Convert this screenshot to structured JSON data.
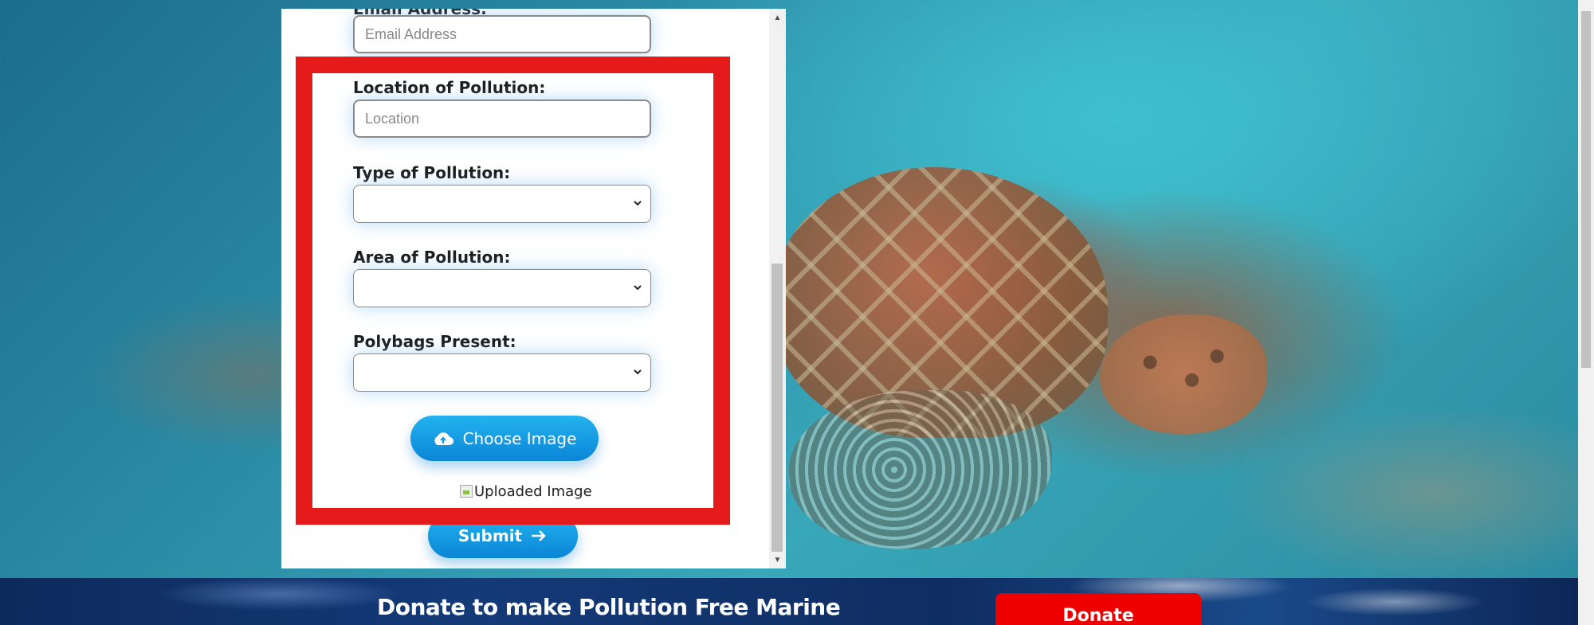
{
  "form": {
    "email": {
      "label": "Email Address:",
      "placeholder": "Email Address"
    },
    "location": {
      "label": "Location of Pollution:",
      "placeholder": "Location"
    },
    "pollution_type": {
      "label": "Type of Pollution:",
      "selected": ""
    },
    "pollution_area": {
      "label": "Area of Pollution:",
      "selected": ""
    },
    "polybags": {
      "label": "Polybags Present:",
      "selected": ""
    },
    "choose_image_label": "Choose Image",
    "uploaded_image_alt": "Uploaded Image",
    "submit_label": "Submit"
  },
  "banner": {
    "text": "Donate to make Pollution Free Marine",
    "donate_label": "Donate"
  },
  "colors": {
    "highlight": "#e51b1b",
    "button_gradient_top": "#23b2ef",
    "button_gradient_bottom": "#0a86d6",
    "donate_button": "#ee0000"
  },
  "icons": {
    "choose_image": "cloud-upload-icon",
    "submit": "arrow-right-icon",
    "select_caret": "chevron-down-icon",
    "broken_image": "broken-image-icon"
  }
}
